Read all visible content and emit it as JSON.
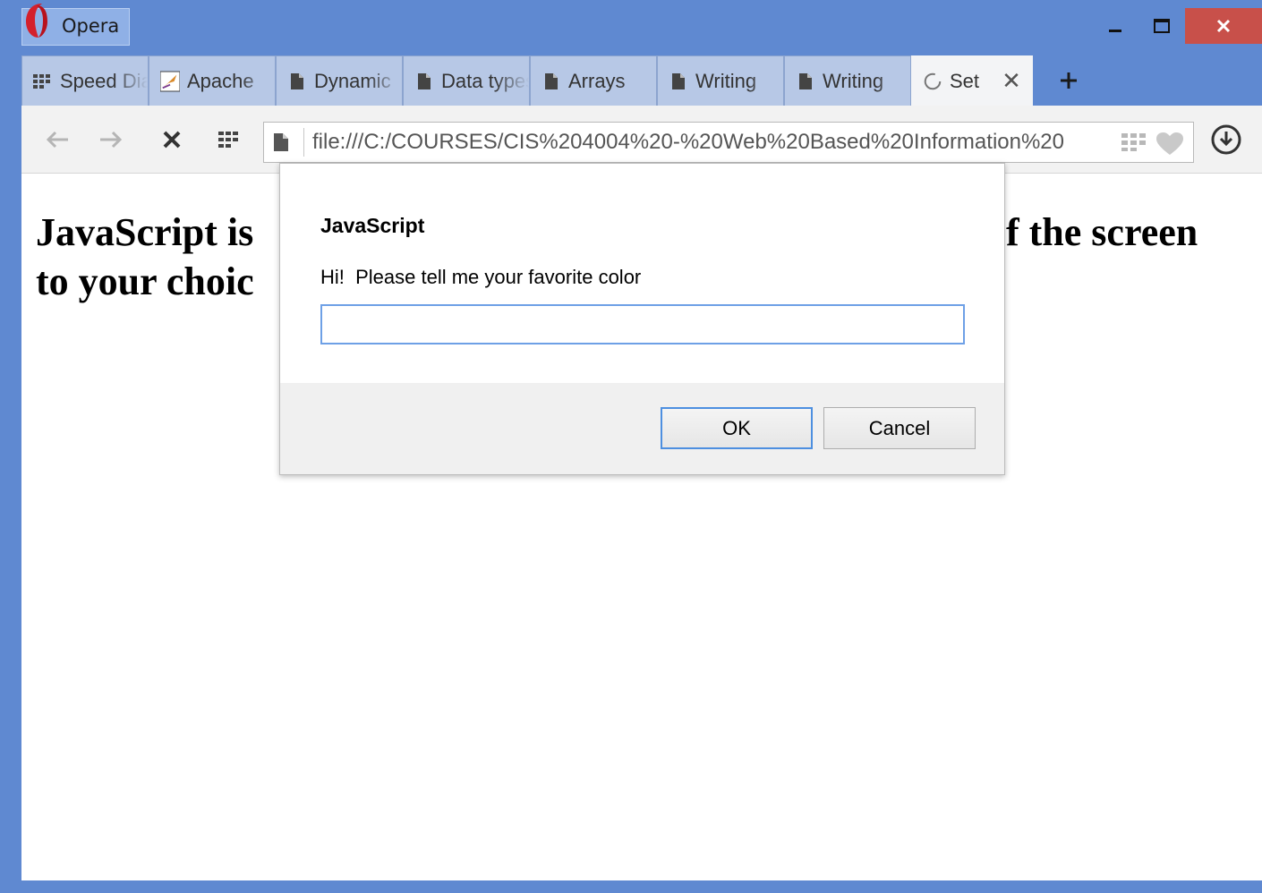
{
  "window": {
    "app_name": "Opera",
    "controls": {
      "minimize": "minimize-icon",
      "maximize": "maximize-icon",
      "close": "close-icon"
    },
    "close_color": "#c8504a",
    "frame_color": "#5f89d1"
  },
  "tabs": [
    {
      "label": "Speed Dial",
      "icon": "speed-dial-icon",
      "active": false
    },
    {
      "label": "Apache",
      "icon": "apache-feather-icon",
      "active": false
    },
    {
      "label": "Dynamic",
      "icon": "document-icon",
      "active": false
    },
    {
      "label": "Data types",
      "icon": "document-icon",
      "active": false
    },
    {
      "label": "Arrays",
      "icon": "document-icon",
      "active": false
    },
    {
      "label": "Writing",
      "icon": "document-icon",
      "active": false
    },
    {
      "label": "Writing",
      "icon": "document-icon",
      "active": false
    },
    {
      "label": "Set",
      "icon": "loading-spinner-icon",
      "active": true
    }
  ],
  "tab_close_glyph": "✕",
  "new_tab_glyph": "+",
  "toolbar": {
    "url": "file:///C:/COURSES/CIS%204004%20-%20Web%20Based%20Information%20",
    "icons": [
      "back-arrow-icon",
      "forward-arrow-icon",
      "stop-icon",
      "speed-dial-icon",
      "document-icon",
      "speed-dial-icon",
      "heart-icon",
      "download-icon"
    ]
  },
  "page": {
    "heading_line1_left": "JavaScript is",
    "heading_line1_right": "f the screen",
    "heading_line2_left": "to your choic"
  },
  "dialog": {
    "title": "JavaScript",
    "message": "Hi!  Please tell me your favorite color",
    "input_value": "",
    "ok_label": "OK",
    "cancel_label": "Cancel",
    "focus_color": "#4d8fe0"
  }
}
